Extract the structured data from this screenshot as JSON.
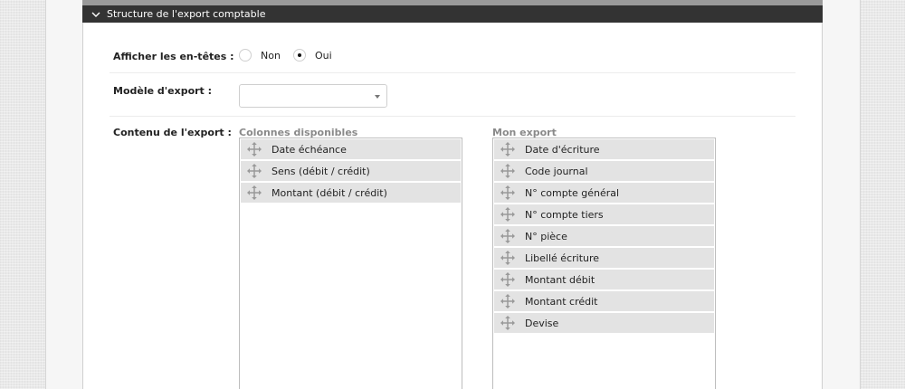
{
  "section": {
    "title": "Structure de l'export comptable"
  },
  "headers_row": {
    "label": "Afficher les en-têtes :",
    "options": [
      {
        "label": "Non",
        "checked": false
      },
      {
        "label": "Oui",
        "checked": true
      }
    ]
  },
  "model_row": {
    "label": "Modèle d'export :",
    "selected_value": ""
  },
  "content_row": {
    "label": "Contenu de l'export :",
    "available": {
      "title": "Colonnes disponibles",
      "items": [
        "Date échéance",
        "Sens (débit / crédit)",
        "Montant (débit / crédit)"
      ]
    },
    "mine": {
      "title": "Mon export",
      "items": [
        "Date d'écriture",
        "Code journal",
        "N° compte général",
        "N° compte tiers",
        "N° pièce",
        "Libellé écriture",
        "Montant débit",
        "Montant crédit",
        "Devise"
      ]
    }
  },
  "colors": {
    "header_bg": "#333333",
    "item_bg": "#e3e3e3",
    "muted_title": "#8a8a8a"
  }
}
